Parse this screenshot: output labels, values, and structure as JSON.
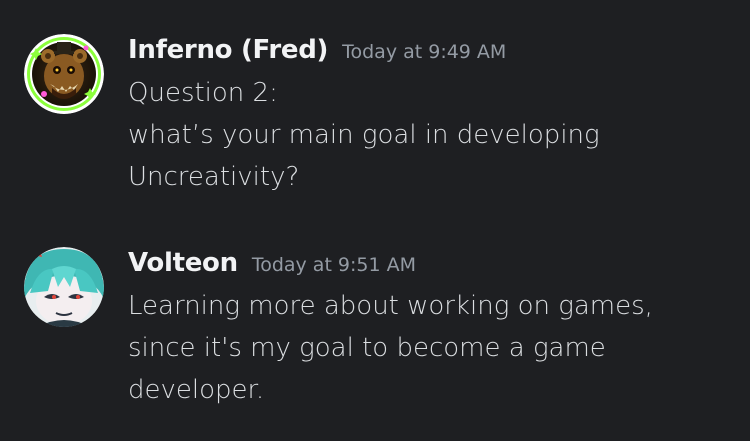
{
  "messages": [
    {
      "author": "Inferno (Fred)",
      "timestamp": "Today at 9:49 AM",
      "avatar_icon": "animatronic-bear-avatar",
      "lines": [
        "Question 2:",
        "what’s your main goal in developing",
        "Uncreativity?"
      ]
    },
    {
      "author": "Volteon",
      "timestamp": "Today at 9:51 AM",
      "avatar_icon": "teal-hair-character-avatar",
      "lines": [
        "Learning more about working on games,",
        "since it's my goal to become a game",
        "developer."
      ]
    }
  ],
  "colors": {
    "background": "#1e1f22",
    "username": "#f2f3f5",
    "timestamp": "#949ba4",
    "text": "#dbdee1",
    "avatar_ring": "#7fff3a"
  }
}
